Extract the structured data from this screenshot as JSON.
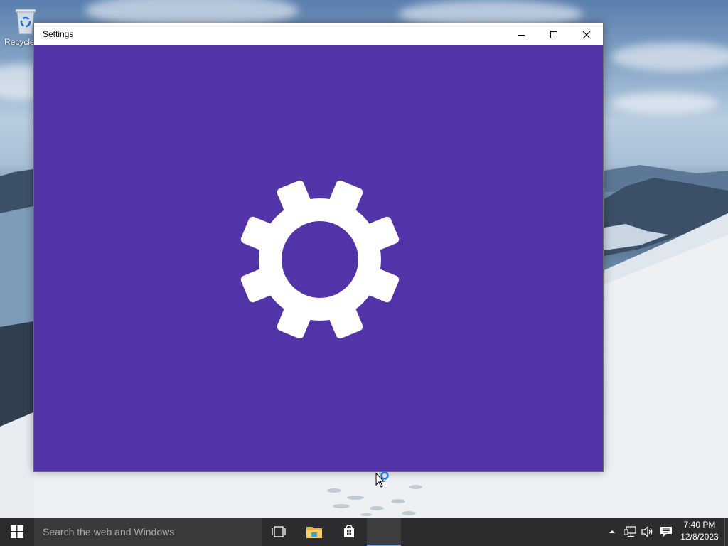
{
  "desktop": {
    "recycle_bin_label": "Recycle Bin"
  },
  "window": {
    "title": "Settings",
    "background_color": "#5233a8",
    "splash_icon": "gear-icon",
    "controls": {
      "minimize_icon": "minimize-icon",
      "maximize_icon": "maximize-icon",
      "close_icon": "close-icon"
    }
  },
  "taskbar": {
    "start_icon": "windows-logo-icon",
    "search_placeholder": "Search the web and Windows",
    "pinned": [
      {
        "name": "Task View",
        "icon": "task-view-icon"
      },
      {
        "name": "File Explorer",
        "icon": "folder-icon"
      },
      {
        "name": "Store",
        "icon": "store-icon"
      },
      {
        "name": "Settings",
        "icon": "settings-app-icon",
        "active": true
      }
    ],
    "tray": {
      "show_hidden_icon": "chevron-up-icon",
      "network_icon": "network-icon",
      "volume_icon": "volume-icon",
      "action_center_icon": "action-center-icon"
    },
    "clock": {
      "time": "7:40 PM",
      "date": "12/8/2023"
    }
  },
  "colors": {
    "accent": "#5233a8",
    "taskbar": "#2c2c2e",
    "active_indicator": "#76a7e0"
  }
}
